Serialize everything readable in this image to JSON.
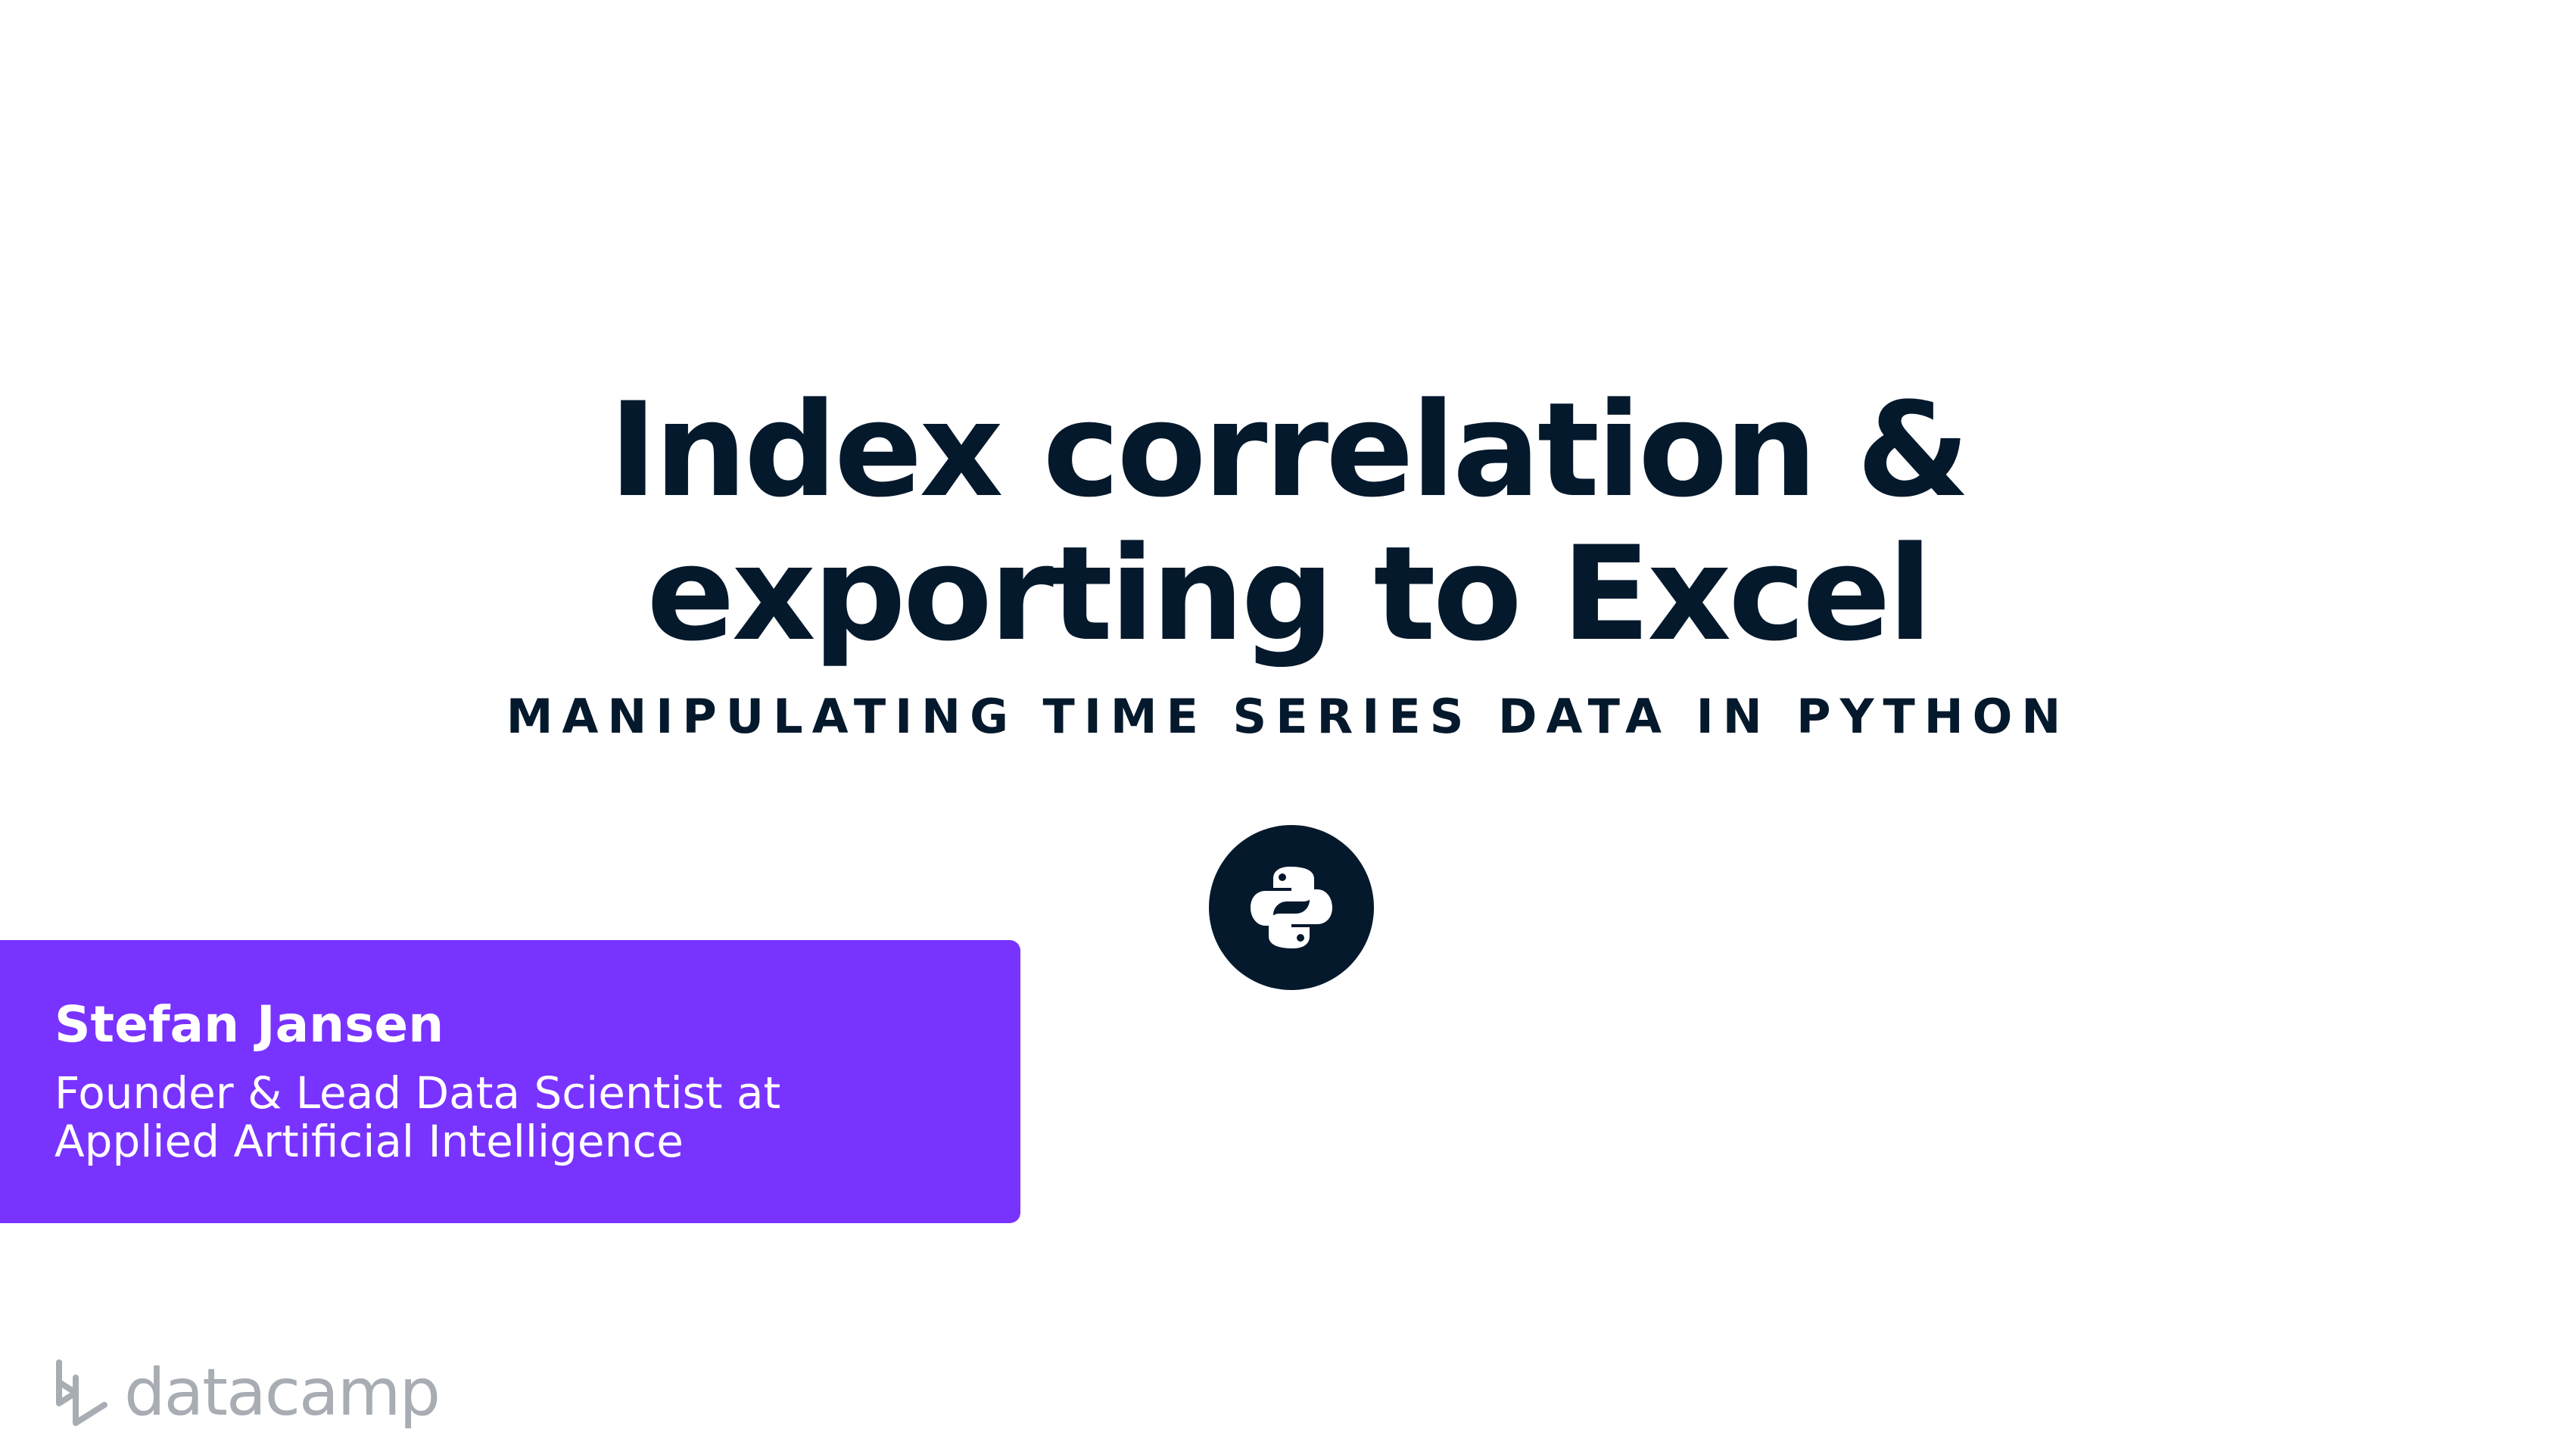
{
  "slide": {
    "title_line_1": "Index correlation &",
    "title_line_2": "exporting to Excel",
    "course_name": "MANIPULATING TIME SERIES DATA IN PYTHON"
  },
  "instructor": {
    "name": "Stefan Jansen",
    "role_line_1": "Founder & Lead Data Scientist at",
    "role_line_2": "Applied Artificial Intelligence"
  },
  "brand": {
    "name": "datacamp",
    "logo_icon": "datacamp-logo-icon"
  },
  "badge": {
    "icon": "python-icon"
  },
  "colors": {
    "title": "#05192d",
    "instructor_card": "#7933ff",
    "badge_background": "#05192d",
    "brand_text": "#a8acb3"
  }
}
